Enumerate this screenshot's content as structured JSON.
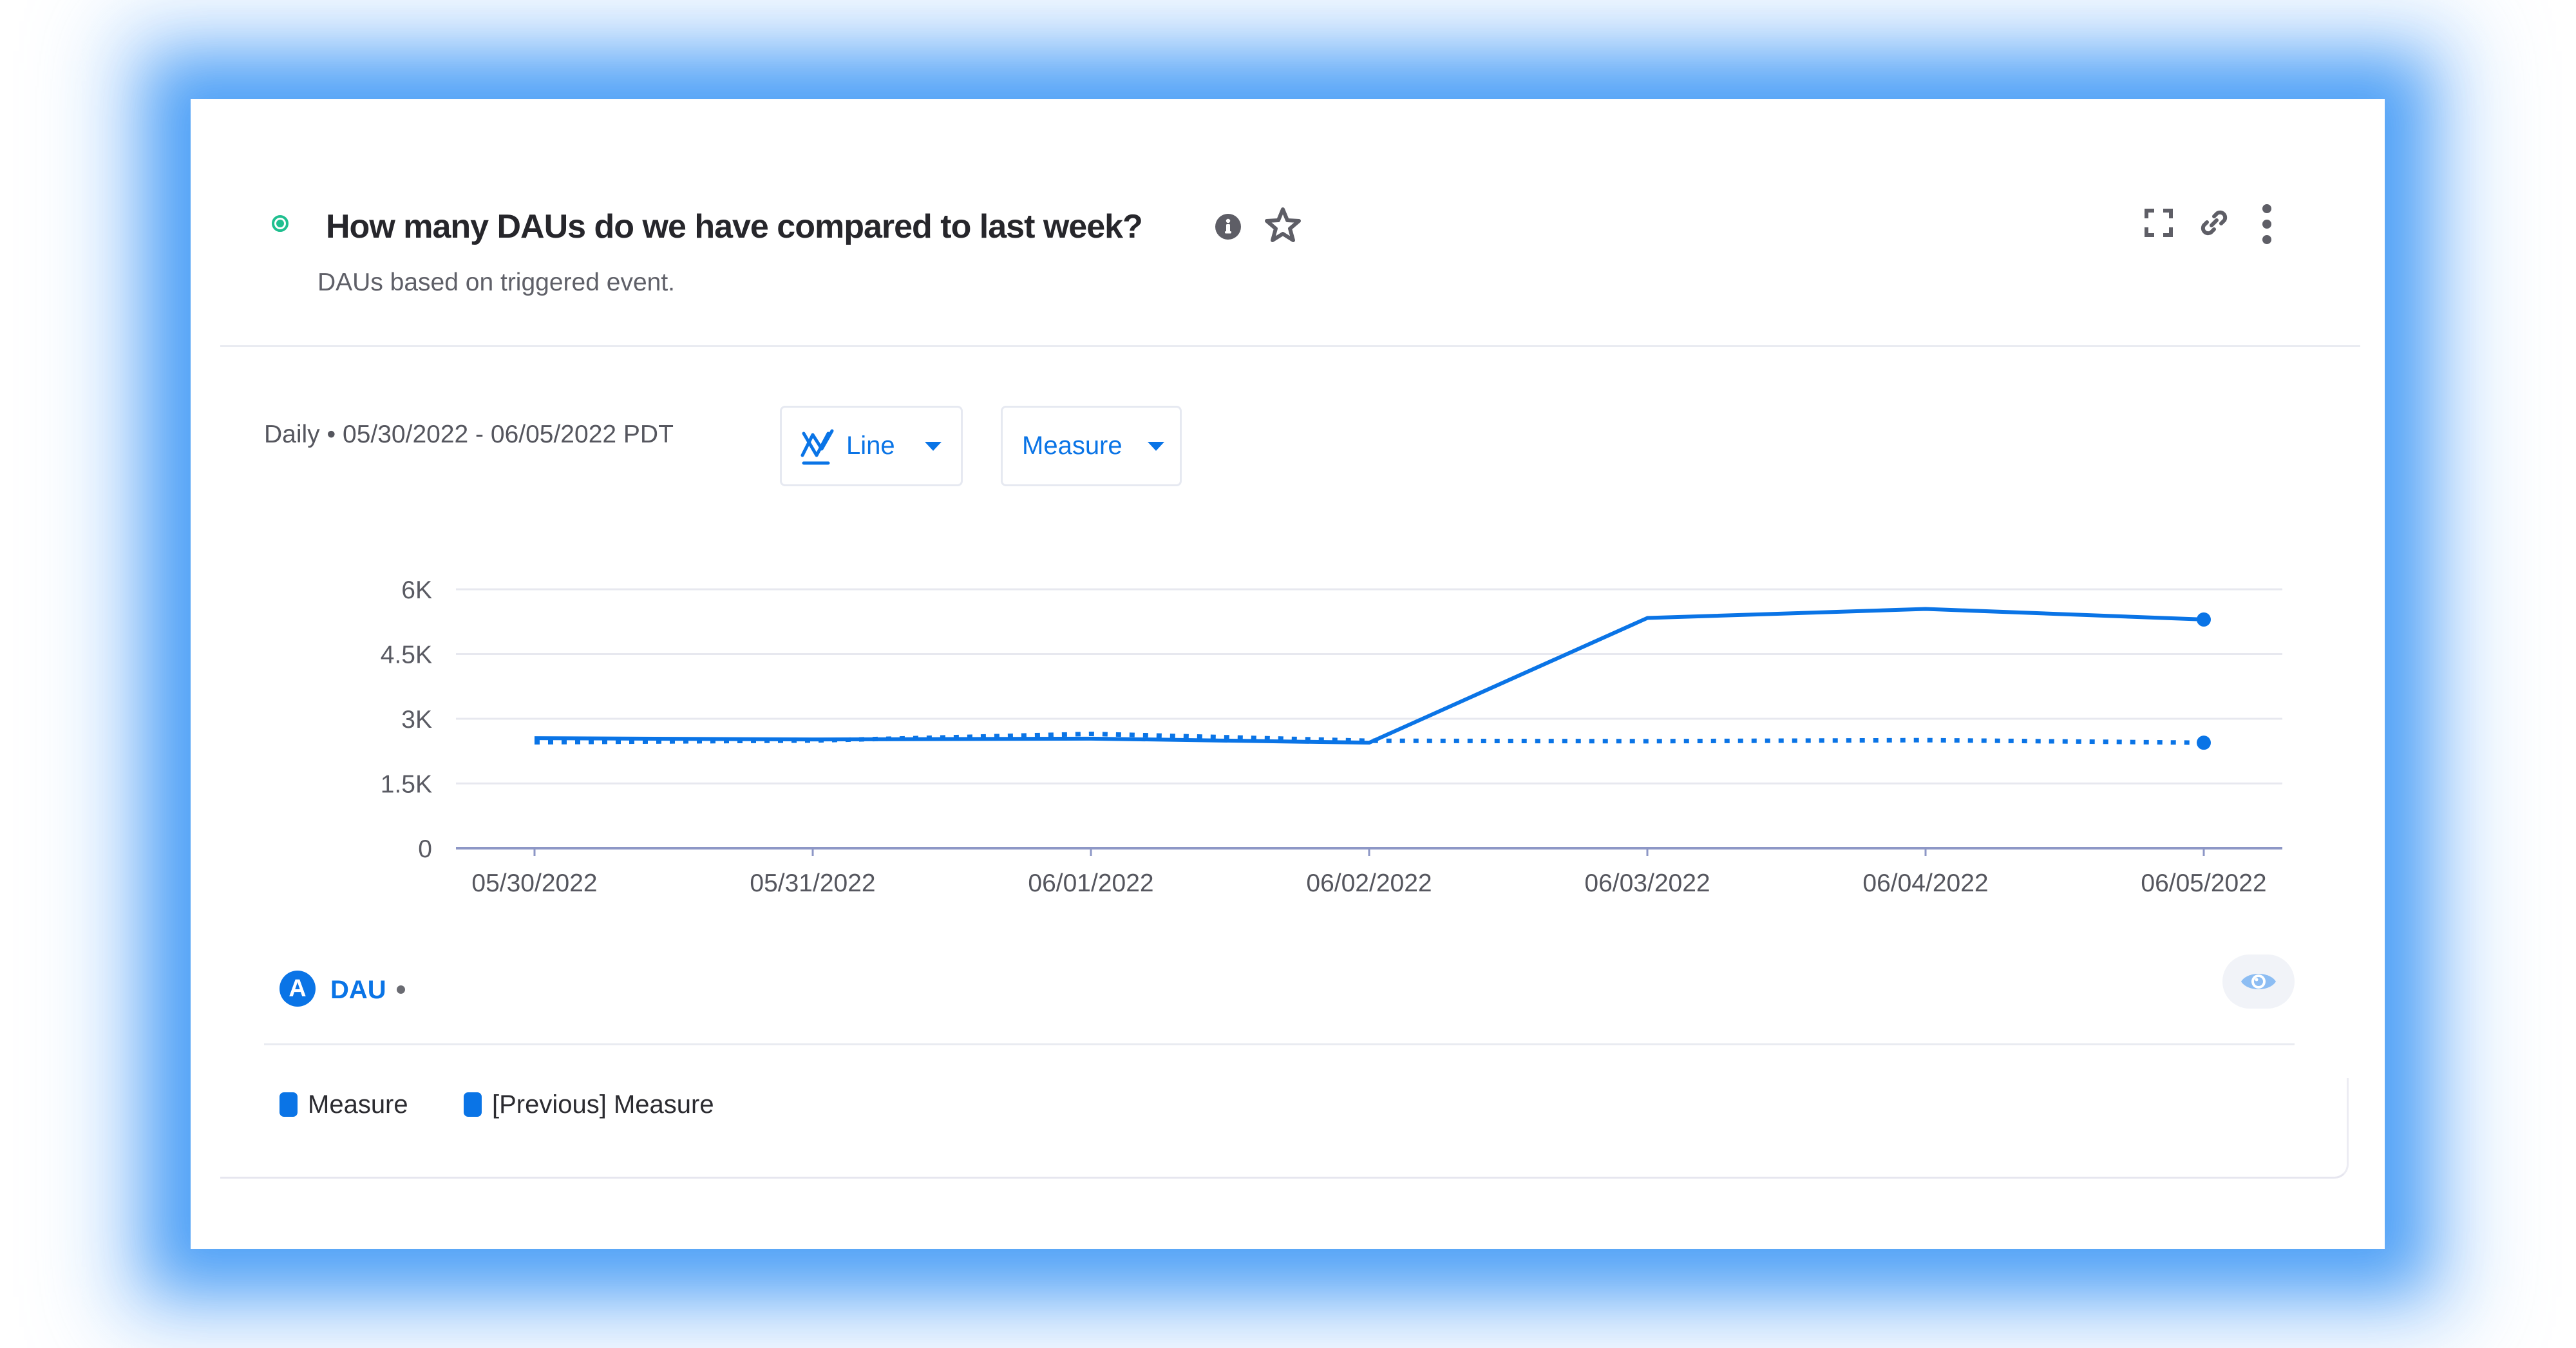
{
  "card": {
    "title": "How many DAUs do we have compared to last week?",
    "subtitle": "DAUs based on triggered event.",
    "status": "active",
    "header_icons": [
      "info-icon",
      "star-icon",
      "fullscreen-icon",
      "link-icon",
      "more-vertical-icon"
    ]
  },
  "controls": {
    "granularity": "Daily",
    "separator": "•",
    "date_range": "05/30/2022 - 06/05/2022 PDT",
    "chart_type_label": "Line",
    "measure_label": "Measure"
  },
  "series_row": {
    "badge": "A",
    "name": "DAU",
    "separator": "•"
  },
  "legend": [
    {
      "label": "Measure",
      "color": "#0a74e6"
    },
    {
      "label": "[Previous] Measure",
      "color": "#0a74e6"
    }
  ],
  "colors": {
    "accent": "#0a74e6",
    "status": "#1fbf8f",
    "glow": "#5ba7f2"
  },
  "chart_data": {
    "type": "line",
    "title": "",
    "xlabel": "",
    "ylabel": "",
    "categories": [
      "05/30/2022",
      "05/31/2022",
      "06/01/2022",
      "06/02/2022",
      "06/03/2022",
      "06/04/2022",
      "06/05/2022"
    ],
    "series": [
      {
        "name": "Measure",
        "style": "solid",
        "color": "#0a74e6",
        "values": [
          2550,
          2520,
          2540,
          2445,
          5335,
          5545,
          5300
        ]
      },
      {
        "name": "[Previous] Measure",
        "style": "dotted",
        "color": "#0a74e6",
        "values": [
          2455,
          2495,
          2650,
          2490,
          2480,
          2505,
          2445
        ]
      }
    ],
    "ylim": [
      0,
      6000
    ],
    "yticks": [
      0,
      1500,
      3000,
      4500,
      6000
    ],
    "ytick_labels": [
      "0",
      "1.5K",
      "3K",
      "4.5K",
      "6K"
    ],
    "grid": true,
    "legend_position": "bottom-left"
  }
}
